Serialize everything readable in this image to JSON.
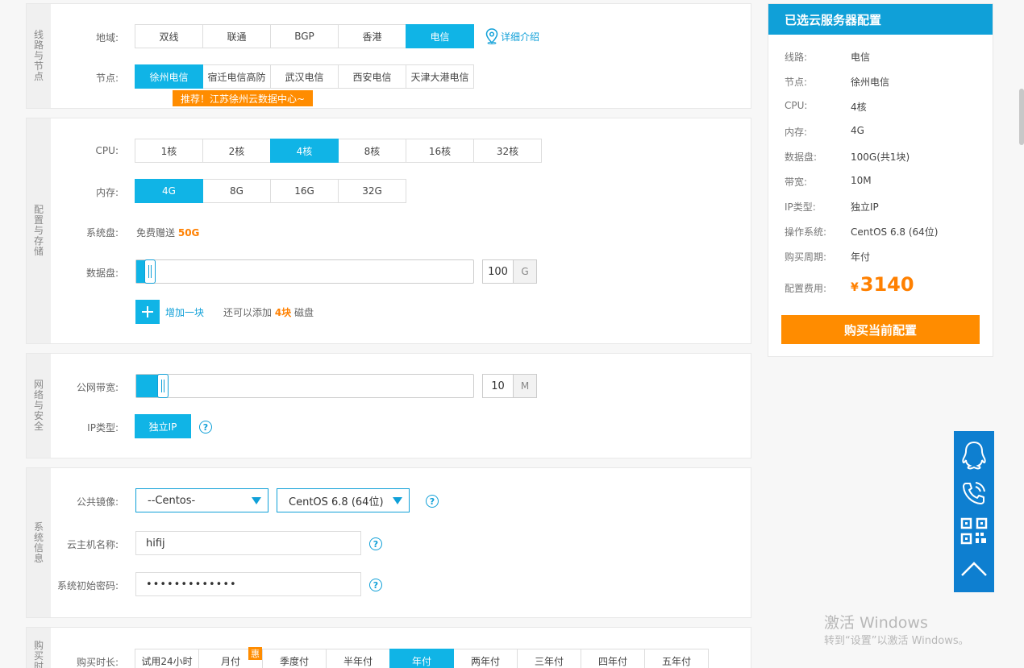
{
  "line_section": {
    "title": "线路与节点",
    "region_label": "地域:",
    "regions": [
      "双线",
      "联通",
      "BGP",
      "香港",
      "电信"
    ],
    "region_active": 4,
    "detail_link": "详细介绍",
    "node_label": "节点:",
    "nodes": [
      "徐州电信",
      "宿迁电信高防",
      "武汉电信",
      "西安电信",
      "天津大港电信"
    ],
    "node_active": 0,
    "promo": "推荐！江苏徐州云数据中心~"
  },
  "config_section": {
    "title": "配置与存储",
    "cpu_label": "CPU:",
    "cpus": [
      "1核",
      "2核",
      "4核",
      "8核",
      "16核",
      "32核"
    ],
    "cpu_active": 2,
    "mem_label": "内存:",
    "mems": [
      "4G",
      "8G",
      "16G",
      "32G"
    ],
    "mem_active": 0,
    "sysdisk_label": "系统盘:",
    "sysdisk_text": "免费赠送",
    "sysdisk_size": "50G",
    "datadisk_label": "数据盘:",
    "datadisk_value": "100",
    "datadisk_unit": "G",
    "datadisk_fraction": 0.02,
    "add_label": "增加一块",
    "add_hint_pre": "还可以添加",
    "add_hint_count": "4块",
    "add_hint_post": "磁盘"
  },
  "network_section": {
    "title": "网络与安全",
    "bw_label": "公网带宽:",
    "bw_value": "10",
    "bw_unit": "M",
    "bw_fraction": 0.05,
    "ip_label": "IP类型:",
    "ip_option": "独立IP"
  },
  "system_section": {
    "title": "系统信息",
    "image_label": "公共镜像:",
    "image_family": "--Centos-",
    "image_version": "CentOS 6.8 (64位)",
    "hostname_label": "云主机名称:",
    "hostname_value": "hifij",
    "password_label": "系统初始密码:",
    "password_value": "•••••••••••••"
  },
  "purchase_section": {
    "title": "购买时长",
    "duration_label": "购买时长:",
    "durations": [
      "试用24小时",
      "月付",
      "季度付",
      "半年付",
      "年付",
      "两年付",
      "三年付",
      "四年付",
      "五年付"
    ],
    "duration_active": 4,
    "discount_badge": "惠"
  },
  "summary": {
    "title": "已选云服务器配置",
    "rows": [
      {
        "label": "线路:",
        "value": "电信"
      },
      {
        "label": "节点:",
        "value": "徐州电信"
      },
      {
        "label": "CPU:",
        "value": "4核"
      },
      {
        "label": "内存:",
        "value": "4G"
      },
      {
        "label": "数据盘:",
        "value": "100G(共1块)"
      },
      {
        "label": "带宽:",
        "value": "10M"
      },
      {
        "label": "IP类型:",
        "value": "独立IP"
      },
      {
        "label": "操作系统:",
        "value": "CentOS 6.8 (64位)"
      },
      {
        "label": "购买周期:",
        "value": "年付"
      }
    ],
    "fee_label": "配置费用:",
    "currency": "¥",
    "price": "3140",
    "buy_button": "购买当前配置"
  },
  "float_bar": {
    "icons": [
      "qq-icon",
      "phone-icon",
      "qrcode-icon",
      "back-to-top-icon"
    ]
  },
  "watermark": {
    "line1": "激活 Windows",
    "line2": "转到“设置”以激活 Windows。"
  },
  "colors": {
    "accent": "#10b4e6",
    "link": "#10a0d8",
    "orange": "#ff8c00",
    "float_bar": "#0e7fd0"
  }
}
